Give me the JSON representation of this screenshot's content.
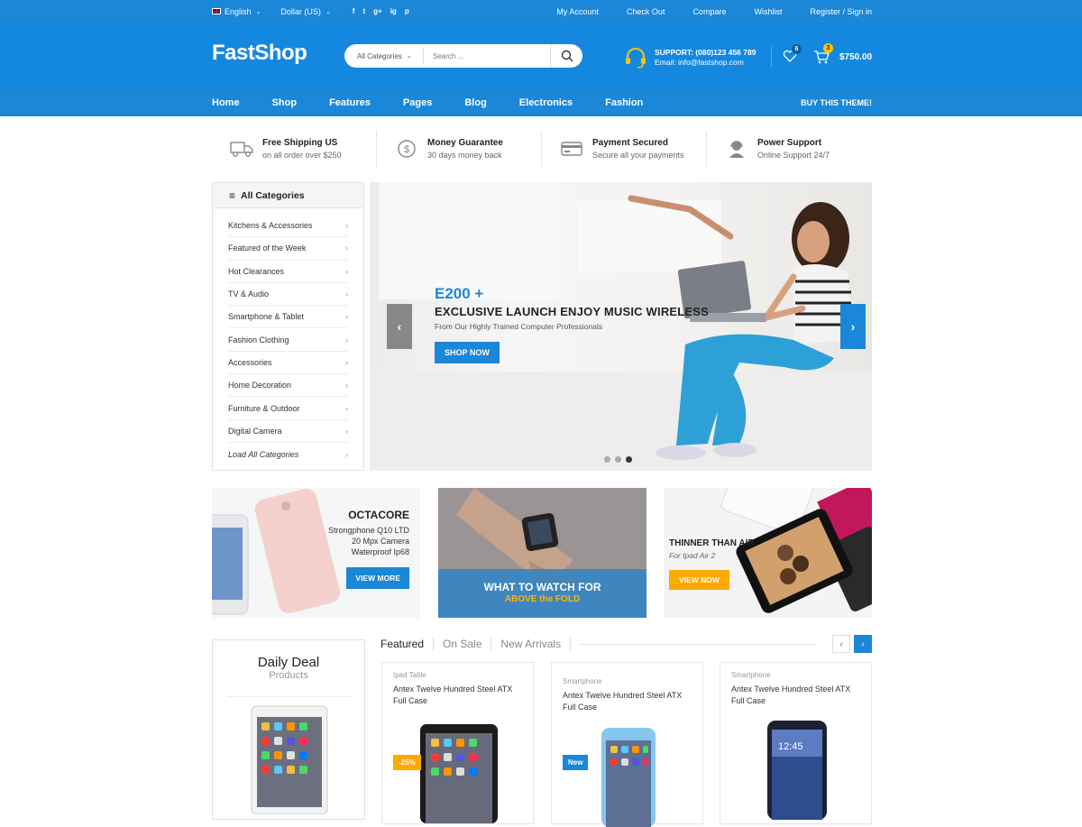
{
  "topbar": {
    "language": "English",
    "currency": "Dollar (US)",
    "social": [
      "f",
      "t",
      "g+",
      "ig",
      "p"
    ],
    "links": [
      "My Account",
      "Check Out",
      "Compare",
      "Wishlist",
      "Register / Sign in"
    ]
  },
  "header": {
    "logo": "FastShop",
    "search_category": "All Categories",
    "search_placeholder": "Search ...",
    "support_phone": "SUPPORT: (080)123 456 789",
    "support_email": "Email: info@fastshop.com",
    "wishlist_count": "6",
    "cart_count": "3",
    "cart_total": "$750.00"
  },
  "nav": {
    "items": [
      "Home",
      "Shop",
      "Features",
      "Pages",
      "Blog",
      "Electronics",
      "Fashion"
    ],
    "buy": "BUY THIS THEME!"
  },
  "features": [
    {
      "title": "Free Shipping US",
      "sub": "on all order over $250",
      "icon": "truck-icon"
    },
    {
      "title": "Money Guarantee",
      "sub": "30 days money back",
      "icon": "money-icon"
    },
    {
      "title": "Payment Secured",
      "sub": "Secure all your payments",
      "icon": "card-icon"
    },
    {
      "title": "Power Support",
      "sub": "Online Support 24/7",
      "icon": "headset-icon"
    }
  ],
  "categories": {
    "title": "All Categories",
    "items": [
      "Kitchens & Accessories",
      "Featured of the Week",
      "Hot Clearances",
      "TV & Audio",
      "Smartphone & Tablet",
      "Fashion Clothing",
      "Accessories",
      "Home Decoration",
      "Furniture & Outdoor",
      "Digital Camera",
      "Load All Categories"
    ]
  },
  "slider": {
    "price": "E200 +",
    "headline": "EXCLUSIVE LAUNCH ENJOY MUSIC WIRELESS",
    "sub": "From Our Highly Trained Computer Professionals",
    "button": "SHOP NOW",
    "active_dot": 3
  },
  "banners": {
    "b1": {
      "title": "OCTACORE",
      "lines": [
        "Strongphone Q10 LTD",
        "20 Mpx Camera",
        "Waterproof Ip68"
      ],
      "button": "VIEW MORE"
    },
    "b2": {
      "line1": "WHAT TO WATCH FOR",
      "line2": "ABOVE the FOLD"
    },
    "b3": {
      "title": "THINNER THAN AIR",
      "sub": "For Ipad Air 2",
      "button": "VIEW NOW"
    }
  },
  "deal": {
    "title": "Daily Deal",
    "sub": "Products"
  },
  "product_tabs": [
    "Featured",
    "On Sale",
    "New Arrivals"
  ],
  "products": [
    {
      "category": "Ipad Table",
      "name": "Antex Twelve Hundred Steel ATX Full Case",
      "badge": "-25%"
    },
    {
      "category": "Smartphone",
      "name": "Antex Twelve Hundred Steel ATX Full Case",
      "badge": "New"
    },
    {
      "category": "Smartphone",
      "name": "Antex Twelve Hundred Steel ATX Full Case",
      "badge": ""
    }
  ],
  "colors": {
    "primary": "#1a87d8",
    "accent": "#ffa800"
  }
}
